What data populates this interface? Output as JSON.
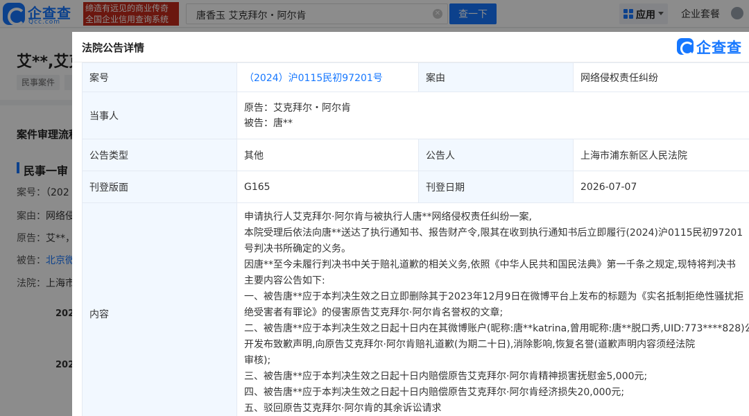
{
  "topbar": {
    "logo_cn": "企查查",
    "logo_en": "Qcc.com",
    "slogan_line1": "缔造有远见的商业传奇",
    "slogan_line2": "全国企业信用查询系统",
    "search_value": "唐香玉 艾克拜尔・阿尔肯",
    "search_button": "查一下",
    "app_menu": "应用",
    "enterprise_package": "企业套餐"
  },
  "background_page": {
    "title": "艾**,艾克",
    "tag": "民事案件",
    "section_title": "案件审理流程",
    "sub_title": "民事一审",
    "rows": [
      {
        "label": "案号：",
        "value": "（202"
      },
      {
        "label": "案由：",
        "value": "网络侵"
      },
      {
        "label": "原告：",
        "value": "艾**，"
      },
      {
        "label": "被告：",
        "value": "北京微"
      },
      {
        "label": "法院：",
        "value": "上海市"
      }
    ],
    "years": [
      "202",
      "202"
    ]
  },
  "modal": {
    "title": "法院公告详情",
    "logo_text": "企查查",
    "case_no_label": "案号",
    "case_no": "（2024）沪0115民初97201号",
    "cause_label": "案由",
    "cause": "网络侵权责任纠纷",
    "parties_label": "当事人",
    "plaintiff": "原告：艾克拜尔・阿尔肯",
    "defendant": "被告：唐**",
    "notice_type_label": "公告类型",
    "notice_type": "其他",
    "announcer_label": "公告人",
    "announcer": "上海市浦东新区人民法院",
    "page_label": "刊登版面",
    "page": "G165",
    "date_label": "刊登日期",
    "date": "2026-07-07",
    "content_label": "内容",
    "content_lines": [
      "申请执行人艾克拜尔·阿尔肯与被执行人唐**网络侵权责任纠纷一案,",
      "本院受理后依法向唐**送达了执行通知书、报告财产令,限其在收到执行通知书后立即履行(2024)沪0115民初97201",
      "号判决书所确定的义务。",
      "因唐**至今未履行判决书中关于赔礼道歉的相关义务,依照《中华人民共和国民法典》第一千条之规定,现特将判决书",
      "主要内容公告如下:",
      "一、被告唐**应于本判决生效之日立即删除其于2023年12月9日在微博平台上发布的标题为《实名抵制拒绝性骚扰拒",
      "绝受害者有罪论》的侵害原告艾克拜尔·阿尔肯名誉权的文章;",
      "二、被告唐**应于本判决生效之日起十日内在其微博账户(昵称:唐**katrina,曾用昵称:唐**脱口秀,UID:773****828)公",
      "开发布致歉声明,向原告艾克拜尔·阿尔肯赔礼道歉(为期二十日),消除影响,恢复名誉(道歉声明内容须经法院",
      "审核);",
      "三、被告唐**应于本判决生效之日起十日内赔偿原告艾克拜尔·阿尔肯精神损害抚慰金5,000元;",
      "四、被告唐**应于本判决生效之日起十日内赔偿原告艾克拜尔·阿尔肯经济损失20,000元;",
      "五、驳回原告艾克拜尔·阿尔肯的其余诉讼请求"
    ]
  },
  "colors": {
    "brand_blue": "#1677ff",
    "slogan_red": "#c42b1c",
    "label_bg": "#f2f8ff"
  }
}
